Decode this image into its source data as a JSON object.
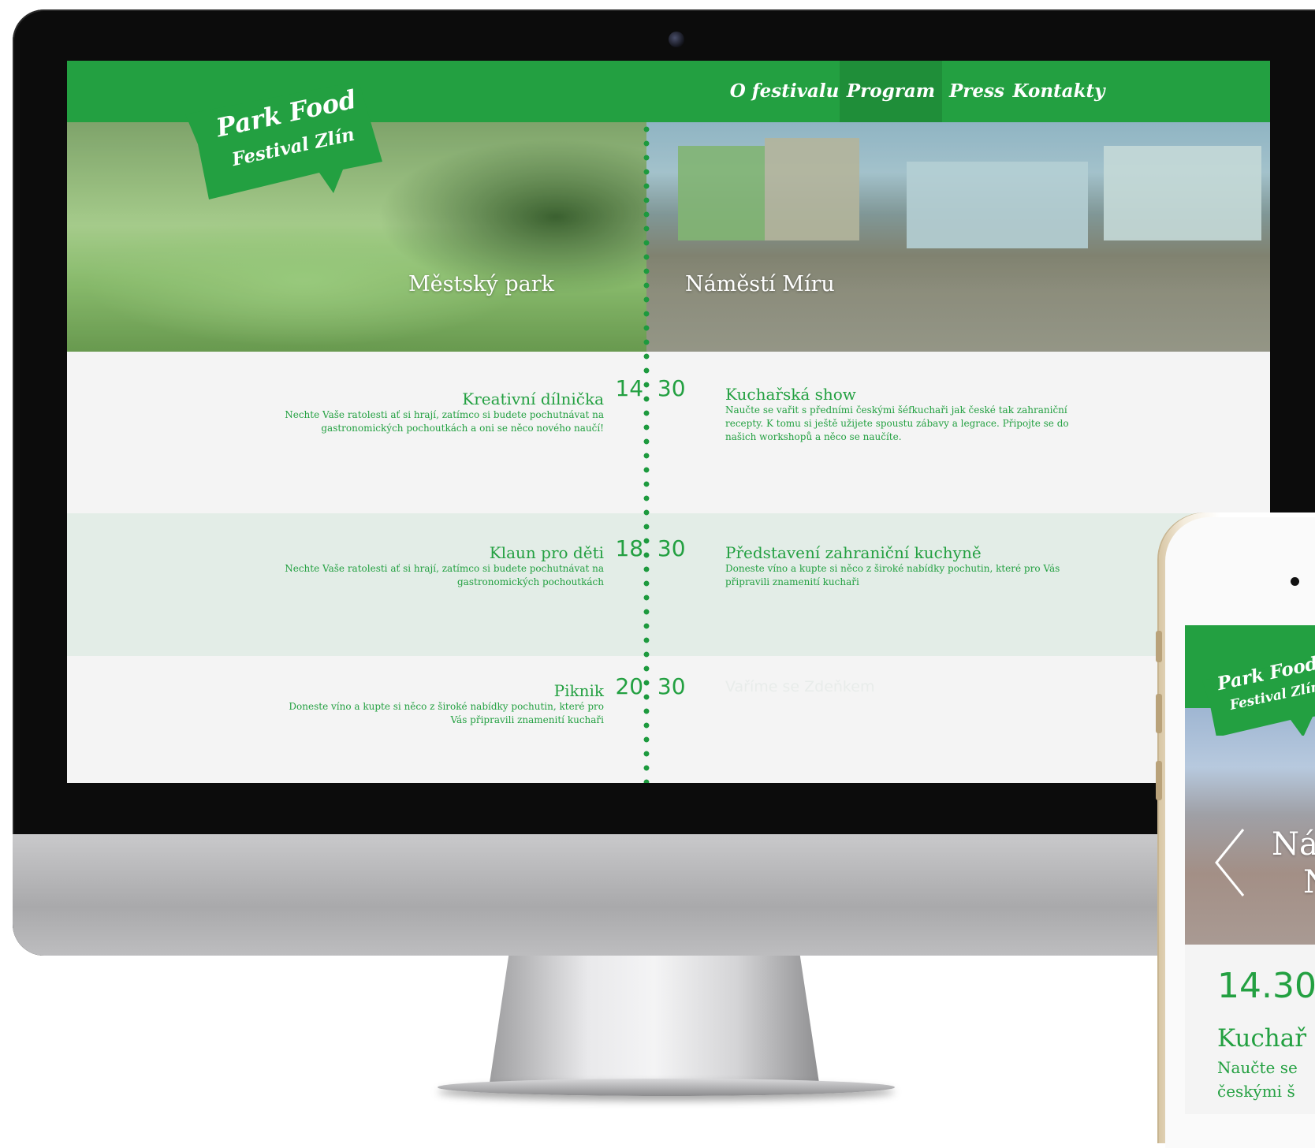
{
  "brand": {
    "line1": "Park Food",
    "line2": "Festival Zlín"
  },
  "nav": {
    "items": [
      {
        "label": "O festivalu",
        "active": false
      },
      {
        "label": "Program",
        "active": true
      },
      {
        "label": "Press",
        "active": false
      },
      {
        "label": "Kontakty",
        "active": false
      }
    ]
  },
  "venues": {
    "left": "Městský park",
    "right": "Náměstí Míru"
  },
  "schedule": [
    {
      "time_hour": "14",
      "time_min": "30",
      "left_title": "Kreativní dílnička",
      "left_desc": "Nechte Vaše ratolesti ať si hrají, zatímco si budete pochutnávat na gastronomických pochoutkách a oni se něco nového naučí!",
      "right_title": "Kuchařská show",
      "right_desc": "Naučte se vařit s předními českými šéfkuchaři jak české tak zahraniční recepty. K tomu si ještě užijete spoustu zábavy a legrace. Připojte se do našich workshopů a něco se naučíte."
    },
    {
      "time_hour": "18",
      "time_min": "30",
      "left_title": "Klaun pro děti",
      "left_desc": "Nechte Vaše ratolesti ať si hrají, zatímco si budete pochutnávat na gastronomických pochoutkách",
      "right_title": "Představení zahraniční kuchyně",
      "right_desc": "Doneste víno a kupte si něco z široké nabídky pochutin, které pro Vás připravili znamenití kuchaři"
    },
    {
      "time_hour": "20",
      "time_min": "30",
      "left_title": "Piknik",
      "left_desc": "Doneste víno a kupte si něco z široké nabídky pochutin, které pro Vás připravili znamenití kuchaři",
      "right_title": "Vaříme se Zdeňkem",
      "right_desc": ""
    }
  ],
  "mobile": {
    "brand_line1": "Park Food",
    "brand_line2": "Festival Zlín",
    "hero_line1": "Ná",
    "hero_line2": "N",
    "prev_icon": "chevron-left-icon",
    "time": "14.30",
    "event_title": "Kuchař",
    "event_desc_line1": "Naučte se",
    "event_desc_line2": "českými š"
  },
  "colors": {
    "brand_green": "#23a041",
    "nav_active": "#1f8e39",
    "row_green": "#e3ede7",
    "row_light": "#f4f4f4"
  }
}
